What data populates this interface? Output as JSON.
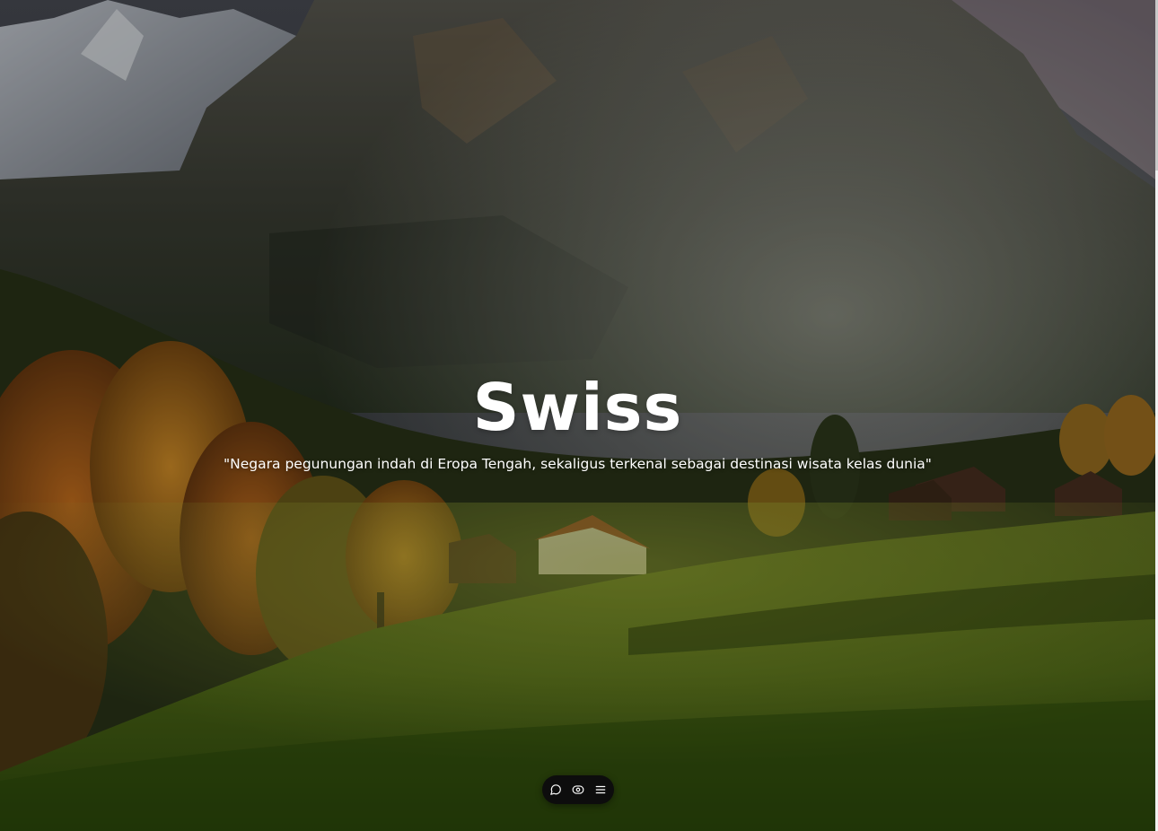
{
  "hero": {
    "title": "Swiss",
    "tagline": "\"Negara pegunungan indah di Eropa Tengah, sekaligus terkenal sebagai destinasi wisata kelas dunia\"",
    "background": "mountain-village-landscape"
  },
  "bottom_nav": {
    "items": [
      {
        "icon": "chat-bubble-icon"
      },
      {
        "icon": "eye-icon"
      },
      {
        "icon": "menu-icon"
      }
    ],
    "background": "#0d0d0d"
  },
  "colors": {
    "title": "#ffffff",
    "text": "#ffffff"
  }
}
